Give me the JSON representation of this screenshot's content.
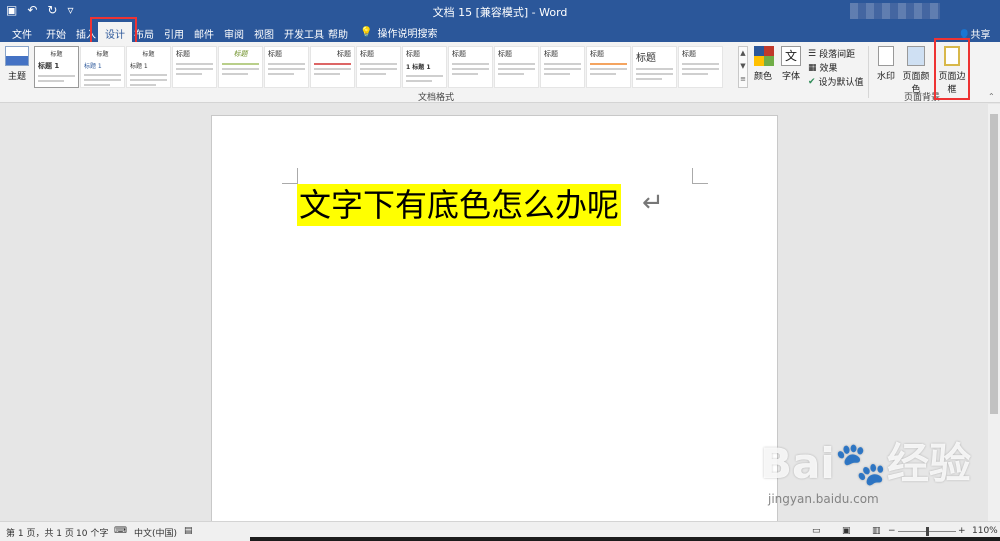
{
  "window": {
    "title": "文档 15 [兼容模式] - Word",
    "qat": {
      "save_icon": "save-icon",
      "undo_icon": "undo-icon",
      "redo_icon": "redo-icon",
      "customize_icon": "chevron-down-icon"
    }
  },
  "tabs": [
    "文件",
    "开始",
    "插入",
    "设计",
    "布局",
    "引用",
    "邮件",
    "审阅",
    "视图",
    "开发工具",
    "帮助"
  ],
  "active_tab": "设计",
  "search": {
    "label": "操作说明搜索"
  },
  "share": {
    "label": "共享"
  },
  "ribbon": {
    "theme_label": "主题",
    "style_first": "标题 1",
    "style_heading_label": "标题",
    "gallery_label": "文档格式",
    "colors_label": "颜色",
    "fonts_label": "字体",
    "paragraph_spacing_label": "段落间距",
    "effects_label": "效果",
    "set_default_label": "设为默认值",
    "watermark_label": "水印",
    "page_color_label": "页面颜色",
    "page_borders_label": "页面边框",
    "background_group_label": "页面背景"
  },
  "document": {
    "text": "文字下有底色怎么办呢",
    "highlight_color": "#ffff00",
    "paragraph_mark": "↵"
  },
  "statusbar": {
    "page": "第 1 页，共 1 页",
    "words": "10 个字",
    "language": "中文(中国)",
    "zoom": "110%"
  },
  "watermark": {
    "brand": "Bai🐾经验",
    "url": "jingyan.baidu.com"
  },
  "colors": {
    "accent": "#2b579a",
    "highlight": "#ffff00",
    "annotation": "#ee3333"
  }
}
